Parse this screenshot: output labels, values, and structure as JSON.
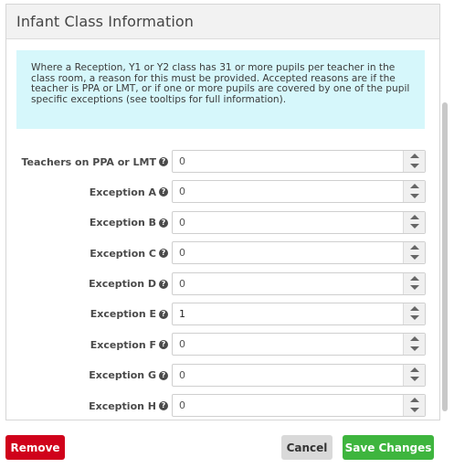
{
  "header": {
    "title": "Infant Class Information"
  },
  "info": {
    "lines": [
      "Where a Reception, Y1 or Y2 class has 31 or more pupils per teacher in the",
      "class room, a reason for this must be provided. Accepted reasons are if the",
      "teacher is PPA or LMT, or if one or more pupils are covered by one of the pupil",
      "specific exceptions (see tooltips for full information)."
    ]
  },
  "fields": [
    {
      "label": "Teachers on PPA or LMT",
      "value": "0"
    },
    {
      "label": "Exception A",
      "value": "0"
    },
    {
      "label": "Exception B",
      "value": "0"
    },
    {
      "label": "Exception C",
      "value": "0"
    },
    {
      "label": "Exception D",
      "value": "0"
    },
    {
      "label": "Exception E",
      "value": "1"
    },
    {
      "label": "Exception F",
      "value": "0"
    },
    {
      "label": "Exception G",
      "value": "0"
    },
    {
      "label": "Exception H",
      "value": "0"
    }
  ],
  "help_icon": {
    "name": "question-circle-icon",
    "glyph": "?"
  },
  "buttons": {
    "remove": "Remove",
    "cancel": "Cancel",
    "save": "Save Changes"
  },
  "colors": {
    "remove": "#d0021b",
    "save": "#3eb53e",
    "cancel": "#d9d9d9",
    "info_bg": "#d6f7fb"
  }
}
